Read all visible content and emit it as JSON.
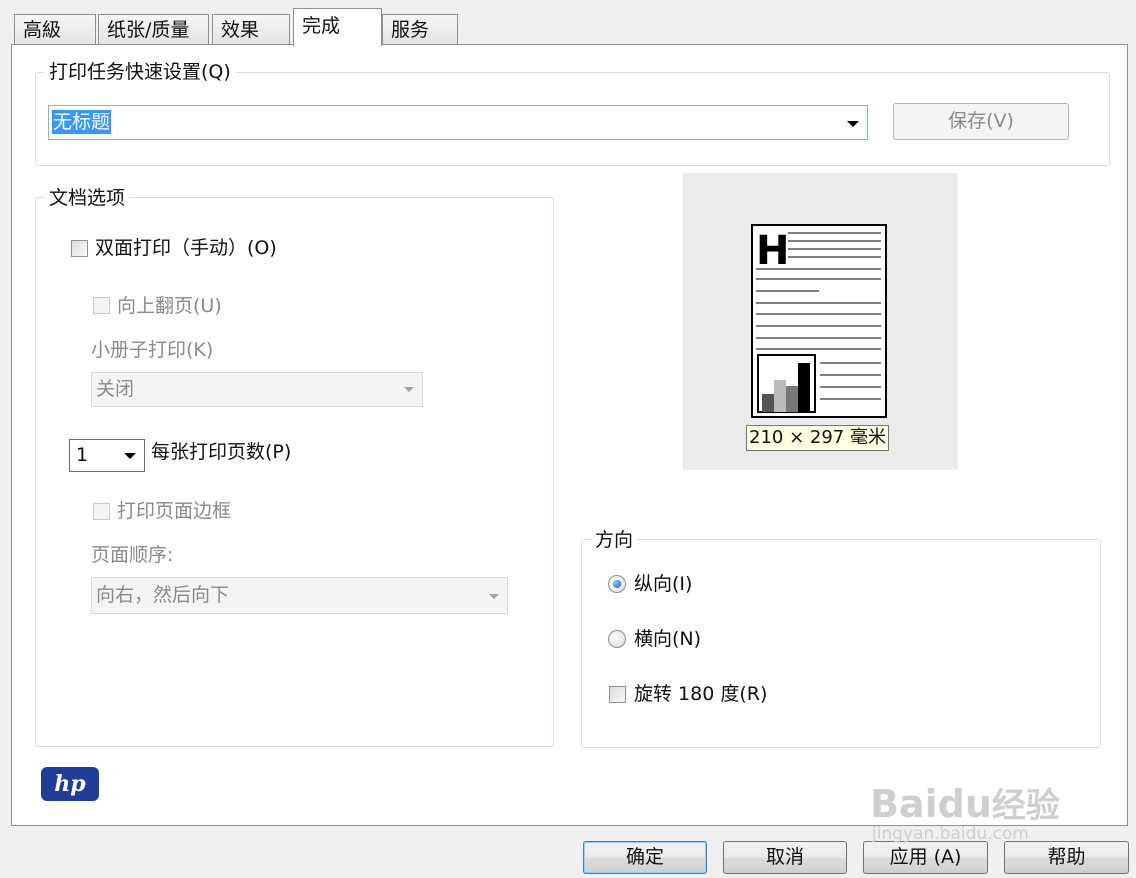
{
  "tabs": [
    {
      "label": "高級"
    },
    {
      "label": "纸张/质量"
    },
    {
      "label": "效果"
    },
    {
      "label": "完成"
    },
    {
      "label": "服务"
    }
  ],
  "quick_settings": {
    "legend": "打印任务快速设置(Q)",
    "value": "无标题",
    "save_label": "保存(V)"
  },
  "document_options": {
    "legend": "文档选项",
    "duplex_label": "双面打印（手动）(O)",
    "flip_up_label": "向上翻页(U)",
    "booklet_label": "小册子打印(K)",
    "booklet_value": "关闭",
    "pages_per_sheet_value": "1",
    "pages_per_sheet_label": "每张打印页数(P)",
    "print_borders_label": "打印页面边框",
    "page_order_label": "页面顺序:",
    "page_order_value": "向右，然后向下"
  },
  "preview": {
    "heading_letter": "H",
    "size_label": "210 × 297 毫米"
  },
  "orientation": {
    "legend": "方向",
    "portrait_label": "纵向(I)",
    "landscape_label": "横向(N)",
    "rotate_label": "旋转 180 度(R)",
    "selected": "portrait"
  },
  "brand": {
    "logo_text": "hp"
  },
  "footer": {
    "ok_label": "确定",
    "cancel_label": "取消",
    "apply_label": "应用 (A)",
    "help_label": "帮助"
  },
  "watermark": {
    "brand": "Bai",
    "paw": "du",
    "suffix": "经验",
    "url": "jingyan.baidu.com"
  }
}
